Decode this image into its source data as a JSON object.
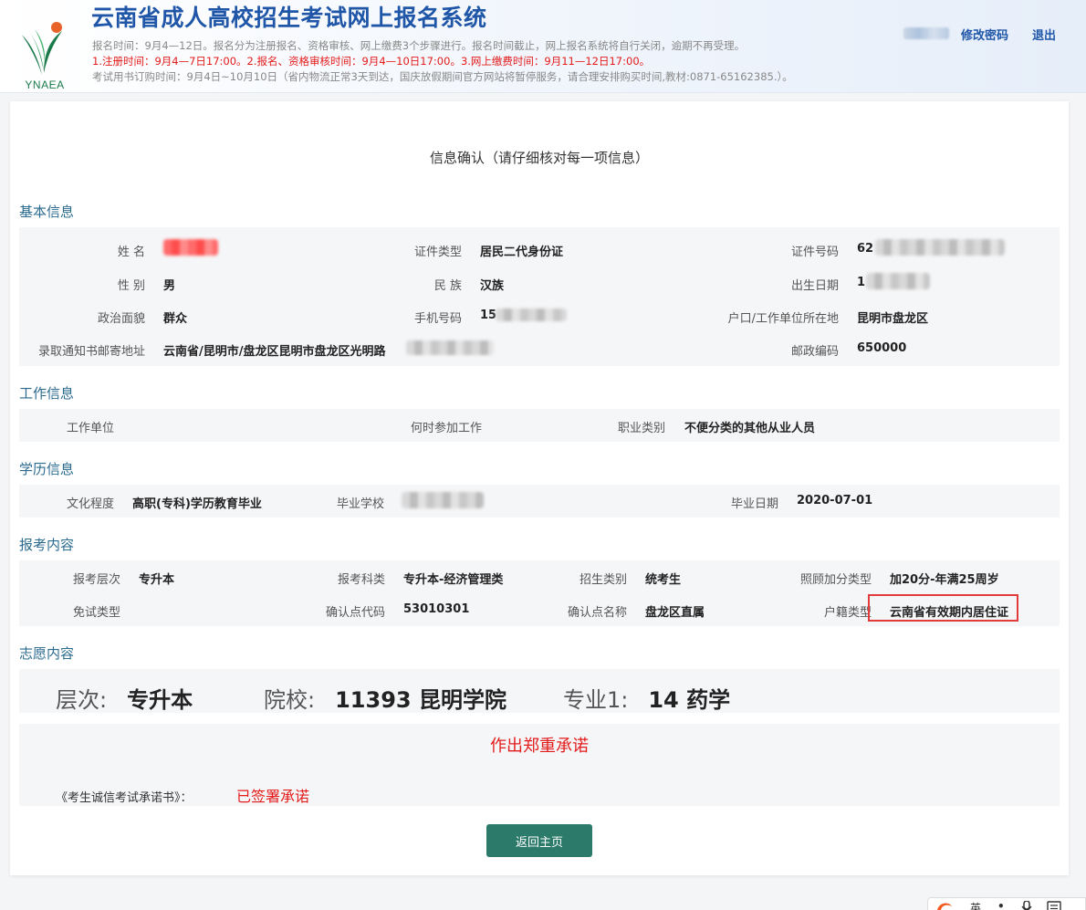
{
  "header": {
    "logo_text": "YNAEA",
    "title": "云南省成人高校招生考试网上报名系统",
    "notice_line1": "报名时间：9月4—12日。报名分为注册报名、资格审核、网上缴费3个步骤进行。报名时间截止，网上报名系统将自行关闭，逾期不再受理。",
    "notice_line2": "1.注册时间：9月4—7日17:00。2.报名、资格审核时间：9月4—10日17:00。3.网上缴费时间：9月11—12日17:00。",
    "notice_line3": "考试用书订购时间：9月4日~10月10日（省内物流正常3天到达，国庆放假期间官方网站将暂停服务，请合理安排购买时间,教材:0871-65162385.）。",
    "change_password": "修改密码",
    "logout": "退出"
  },
  "page_heading": "信息确认（请仔细核对每一项信息）",
  "basic": {
    "section_title": "基本信息",
    "name_label": "姓 名",
    "id_type_label": "证件类型",
    "id_type_value": "居民二代身份证",
    "id_number_label": "证件号码",
    "id_number_value": "62",
    "gender_label": "性 别",
    "gender_value": "男",
    "ethnicity_label": "民 族",
    "ethnicity_value": "汉族",
    "birth_label": "出生日期",
    "birth_value": "1",
    "political_label": "政治面貌",
    "political_value": "群众",
    "phone_label": "手机号码",
    "phone_value": "15",
    "residence_label": "户口/工作单位所在地",
    "residence_value": "昆明市盘龙区",
    "address_label": "录取通知书邮寄地址",
    "address_value": "云南省/昆明市/盘龙区昆明市盘龙区光明路",
    "postcode_label": "邮政编码",
    "postcode_value": "650000"
  },
  "work": {
    "section_title": "工作信息",
    "employer_label": "工作单位",
    "start_label": "何时参加工作",
    "occupation_label": "职业类别",
    "occupation_value": "不便分类的其他从业人员"
  },
  "education": {
    "section_title": "学历信息",
    "level_label": "文化程度",
    "level_value": "高职(专科)学历教育毕业",
    "school_label": "毕业学校",
    "grad_date_label": "毕业日期",
    "grad_date_value": "2020-07-01"
  },
  "exam": {
    "section_title": "报考内容",
    "tier_label": "报考层次",
    "tier_value": "专升本",
    "subject_label": "报考科类",
    "subject_value": "专升本-经济管理类",
    "category_label": "招生类别",
    "category_value": "统考生",
    "bonus_label": "照顾加分类型",
    "bonus_value": "加20分-年满25周岁",
    "exempt_label": "免试类型",
    "site_code_label": "确认点代码",
    "site_code_value": "53010301",
    "site_name_label": "确认点名称",
    "site_name_value": "盘龙区直属",
    "household_label": "户籍类型",
    "household_value": "云南省有效期内居住证"
  },
  "wish": {
    "section_title": "志愿内容",
    "tier_label": "层次:",
    "tier_value": "专升本",
    "school_label": "院校:",
    "school_value": "11393 昆明学院",
    "major_label": "专业1:",
    "major_value": "14 药学"
  },
  "pledge": {
    "title": "作出郑重承诺",
    "doc_label": "《考生诚信考试承诺书》：",
    "status": "已签署承诺"
  },
  "back_button": "返回主页",
  "ime_bar": {
    "lang": "英"
  }
}
